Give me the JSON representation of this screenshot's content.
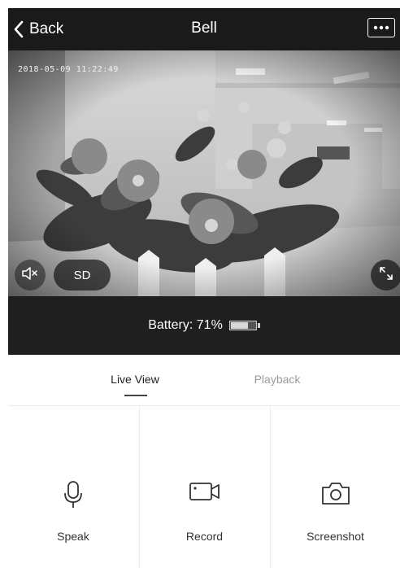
{
  "header": {
    "back_label": "Back",
    "title": "Bell",
    "more_icon": "ellipsis-icon"
  },
  "video": {
    "timestamp": "2018-05-09 11:22:49",
    "mute_icon": "speaker-muted-icon",
    "quality_label": "SD",
    "fullscreen_icon": "fullscreen-icon"
  },
  "battery": {
    "text": "Battery: 71%",
    "level": 0.71
  },
  "tabs": [
    {
      "label": "Live View",
      "active": true
    },
    {
      "label": "Playback",
      "active": false
    }
  ],
  "actions": [
    {
      "label": "Speak",
      "icon": "microphone-icon"
    },
    {
      "label": "Record",
      "icon": "video-camera-icon"
    },
    {
      "label": "Screenshot",
      "icon": "camera-icon"
    }
  ],
  "colors": {
    "header_bg": "#1a1a1a",
    "battery_bar_bg": "#1f1f1f",
    "active_tab": "#222222",
    "inactive_tab": "#9a9a9a"
  }
}
